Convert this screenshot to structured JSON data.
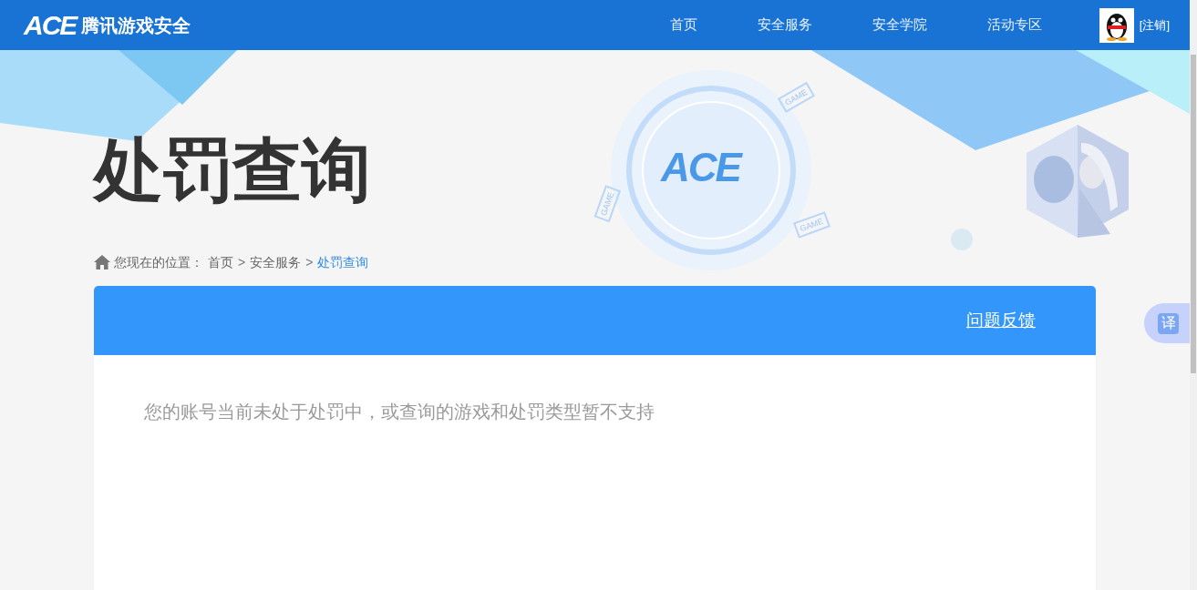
{
  "header": {
    "logo": "ACE",
    "site_name": "腾讯游戏安全",
    "nav": [
      {
        "label": "首页",
        "selected": false
      },
      {
        "label": "安全服务",
        "selected": false
      },
      {
        "label": "安全学院",
        "selected": false
      },
      {
        "label": "活动专区",
        "selected": false
      }
    ],
    "logout": "[注销]"
  },
  "hero": {
    "title": "处罚查询",
    "emblem": "ACE",
    "device_labels": [
      "GAME",
      "GAME",
      "GAME"
    ],
    "portrait": {
      "kind": "picture"
    }
  },
  "breadcrumb": {
    "prefix": "您现在的位置：",
    "items": [
      {
        "label": "首页",
        "current": false
      },
      {
        "label": "安全服务",
        "current": false
      },
      {
        "label": "处罚查询",
        "current": true
      }
    ],
    "separator": ">"
  },
  "panel": {
    "feedback_link": "问题反馈",
    "message": "您的账号当前未处于处罚中，或查询的游戏和处罚类型暂不支持"
  },
  "translate_button": "译"
}
